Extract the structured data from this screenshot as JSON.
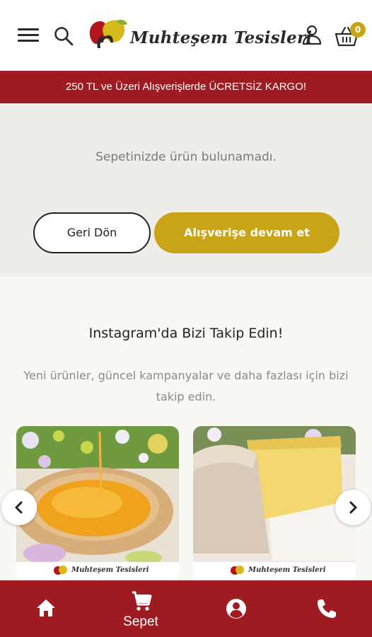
{
  "header": {
    "brand": "Muhteşem Tesisleri",
    "cart_count": "0"
  },
  "promo": {
    "text": "250 TL ve Üzeri Alışverişlerde ÜCRETSİZ KARGO!"
  },
  "cart": {
    "empty_message": "Sepetinizde ürün bulunamadı.",
    "back_label": "Geri Dön",
    "continue_label": "Alışverişe devam et"
  },
  "instagram": {
    "title": "Instagram'da Bizi Takip Edin!",
    "subtitle": "Yeni ürünler, güncel kampanyalar ve daha fazlası için bizi takip edin.",
    "cards": [
      {
        "watermark": "Muhteşem Tesisleri"
      },
      {
        "watermark": "Muhteşem Tesisleri"
      }
    ]
  },
  "bottom_nav": {
    "cart_label": "Sepet"
  },
  "colors": {
    "brand_red": "#9e1b22",
    "accent_gold": "#c9a417",
    "cart_bg": "#efedea",
    "page_bg": "#faf8f4"
  },
  "icons": [
    "menu-icon",
    "search-icon",
    "user-icon",
    "basket-icon",
    "chevron-left-icon",
    "chevron-right-icon",
    "home-icon",
    "cart-icon",
    "account-icon",
    "phone-icon"
  ]
}
